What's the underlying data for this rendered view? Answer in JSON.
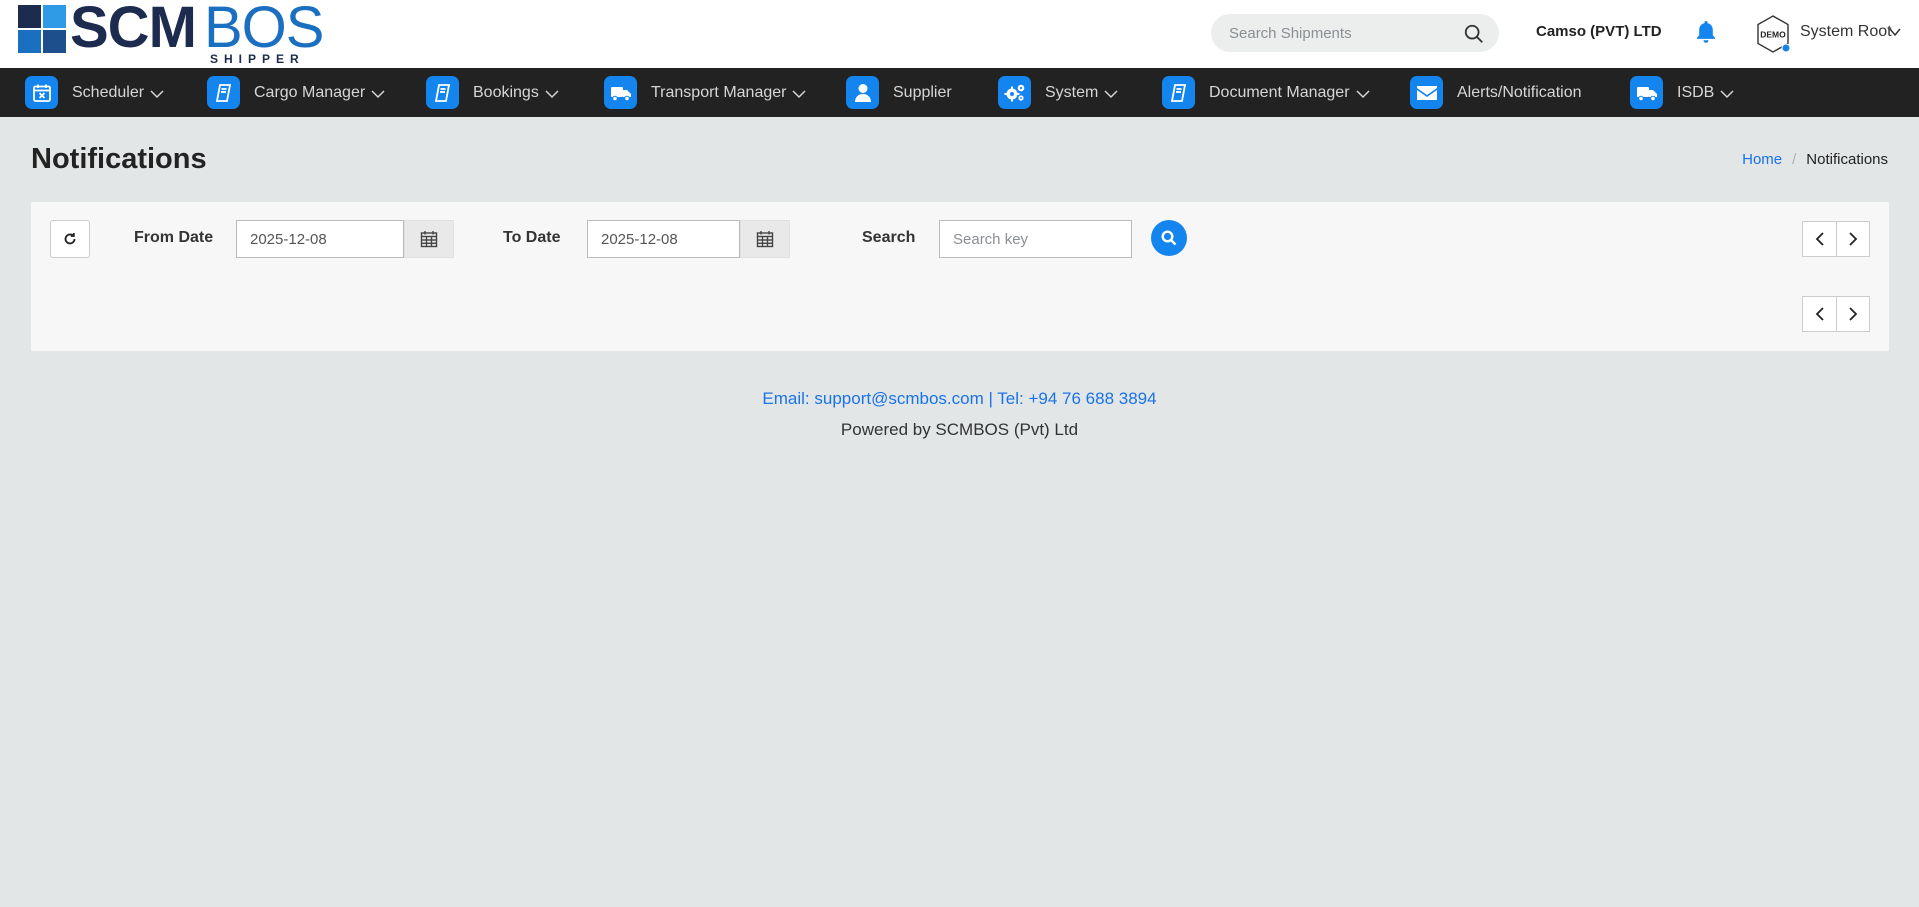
{
  "logo": {
    "primary": "SCM",
    "secondary": "BOS",
    "tagline": "SHIPPER"
  },
  "header": {
    "search_placeholder": "Search Shipments",
    "company": "Camso (PVT) LTD",
    "avatar_text": "DEMO",
    "user": "System Root"
  },
  "nav": {
    "items": [
      {
        "label": "Scheduler",
        "icon": "calendar-icon",
        "has_dropdown": true
      },
      {
        "label": "Cargo Manager",
        "icon": "book-icon",
        "has_dropdown": true
      },
      {
        "label": "Bookings",
        "icon": "book-icon",
        "has_dropdown": true
      },
      {
        "label": "Transport Manager",
        "icon": "truck-icon",
        "has_dropdown": true
      },
      {
        "label": "Supplier",
        "icon": "user-icon",
        "has_dropdown": false
      },
      {
        "label": "System",
        "icon": "cogs-icon",
        "has_dropdown": true
      },
      {
        "label": "Document Manager",
        "icon": "book-icon",
        "has_dropdown": true
      },
      {
        "label": "Alerts/Notification",
        "icon": "envelope-icon",
        "has_dropdown": false
      },
      {
        "label": "ISDB",
        "icon": "truck-icon",
        "has_dropdown": true
      }
    ]
  },
  "page": {
    "title": "Notifications",
    "breadcrumb": {
      "home": "Home",
      "separator": "/",
      "current": "Notifications"
    }
  },
  "filters": {
    "from_label": "From Date",
    "from_value": "2025-12-08",
    "to_label": "To Date",
    "to_value": "2025-12-08",
    "search_label": "Search",
    "search_placeholder": "Search key"
  },
  "footer": {
    "contact": "Email: support@scmbos.com | Tel: +94 76 688 3894",
    "powered": "Powered by SCMBOS (Pvt) Ltd"
  },
  "colors": {
    "accent": "#1485ee",
    "nav_bg": "#222222",
    "page_bg": "#e3e6e7",
    "link": "#1a73e8",
    "logo_dark": "#1c2b4e",
    "logo_blue": "#1a6fc0"
  }
}
